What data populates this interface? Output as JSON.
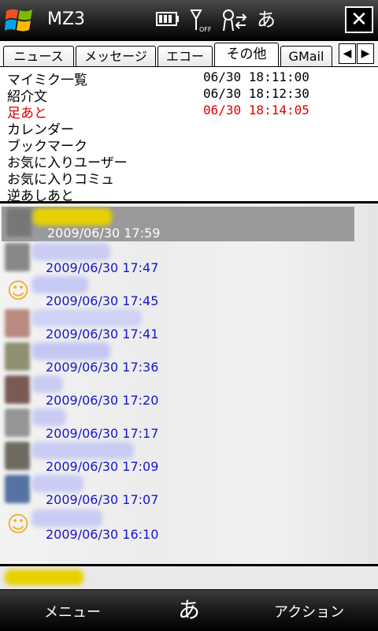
{
  "status_bar": {
    "app_name": "MZ3",
    "ime_char": "あ",
    "close_label": "✕"
  },
  "tabs": [
    {
      "label": "ニュース",
      "active": false
    },
    {
      "label": "メッセージ",
      "active": false
    },
    {
      "label": "エコー",
      "active": false
    },
    {
      "label": "その他",
      "active": true
    },
    {
      "label": "GMail",
      "active": false
    }
  ],
  "tab_nav": {
    "prev": "◀",
    "next": "▶"
  },
  "categories": [
    {
      "label": "マイミク一覧",
      "time": "06/30 18:11:00",
      "highlight": false
    },
    {
      "label": "紹介文",
      "time": "06/30 18:12:30",
      "highlight": false
    },
    {
      "label": "足あと",
      "time": "06/30 18:14:05",
      "highlight": true
    },
    {
      "label": "カレンダー",
      "time": "",
      "highlight": false
    },
    {
      "label": "ブックマーク",
      "time": "",
      "highlight": false
    },
    {
      "label": "お気に入りユーザー",
      "time": "",
      "highlight": false
    },
    {
      "label": "お気に入りコミュ",
      "time": "",
      "highlight": false
    },
    {
      "label": "逆あしあと",
      "time": "",
      "highlight": false
    }
  ],
  "entries": [
    {
      "date": "2009/06/30 17:59",
      "selected": true
    },
    {
      "date": "2009/06/30 17:47",
      "selected": false
    },
    {
      "date": "2009/06/30 17:45",
      "selected": false
    },
    {
      "date": "2009/06/30 17:41",
      "selected": false
    },
    {
      "date": "2009/06/30 17:36",
      "selected": false
    },
    {
      "date": "2009/06/30 17:20",
      "selected": false
    },
    {
      "date": "2009/06/30 17:17",
      "selected": false
    },
    {
      "date": "2009/06/30 17:09",
      "selected": false
    },
    {
      "date": "2009/06/30 17:07",
      "selected": false
    },
    {
      "date": "2009/06/30 16:10",
      "selected": false
    }
  ],
  "softkeys": {
    "left": "メニュー",
    "center": "あ",
    "right": "アクション"
  },
  "colors": {
    "highlight_red": "#e00000",
    "date_blue": "#1515cc",
    "selected_bg": "#9a9a9a"
  }
}
